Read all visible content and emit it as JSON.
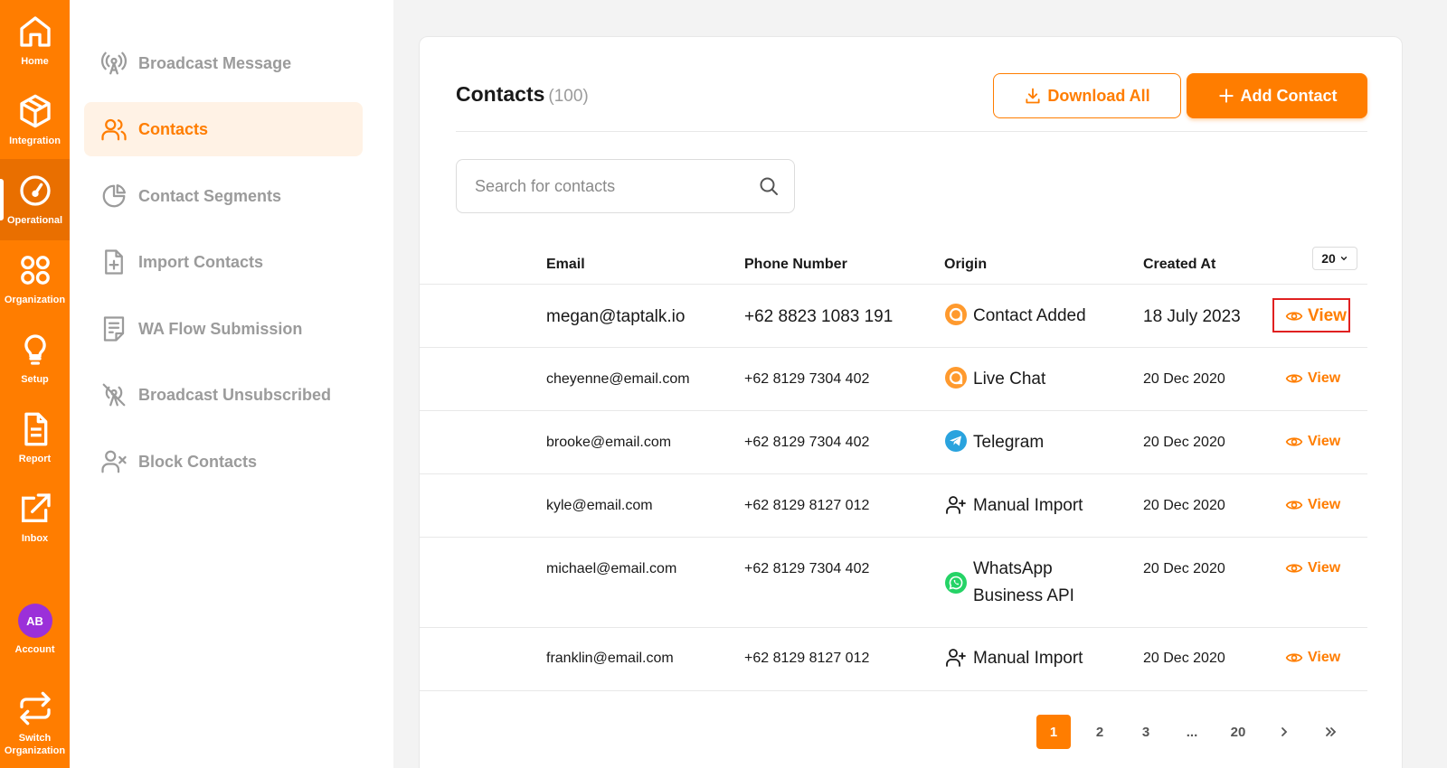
{
  "rail": {
    "home": "Home",
    "integration": "Integration",
    "operational": "Operational",
    "organization": "Organization",
    "setup": "Setup",
    "report": "Report",
    "inbox": "Inbox",
    "avatar_initials": "AB",
    "account": "Account",
    "switch_org": "Switch Organization"
  },
  "submenu": {
    "items": [
      {
        "label": "Broadcast Message",
        "icon": "broadcast-icon"
      },
      {
        "label": "Contacts",
        "icon": "contacts-icon",
        "active": true
      },
      {
        "label": "Contact Segments",
        "icon": "pie-chart-icon"
      },
      {
        "label": "Import Contacts",
        "icon": "file-plus-icon"
      },
      {
        "label": "WA Flow Submission",
        "icon": "form-icon"
      },
      {
        "label": "Broadcast Unsubscribed",
        "icon": "broadcast-off-icon"
      },
      {
        "label": "Block Contacts",
        "icon": "user-x-icon"
      }
    ]
  },
  "main": {
    "title": "Contacts",
    "count": "(100)",
    "download_label": "Download All",
    "add_label": "Add Contact",
    "search_placeholder": "Search for contacts",
    "per_page": "20"
  },
  "table": {
    "headers": {
      "email": "Email",
      "phone": "Phone Number",
      "origin": "Origin",
      "created": "Created At"
    },
    "view_label": "View",
    "rows": [
      {
        "email": "megan@taptalk.io",
        "phone": "+62 8823 1083 191",
        "origin": "Contact Added",
        "origin_icon": "livechat-icon",
        "created": "18 July 2023"
      },
      {
        "email": "cheyenne@email.com",
        "phone": "+62 8129 7304 402",
        "origin": "Live Chat",
        "origin_icon": "livechat-icon",
        "created": "20 Dec 2020"
      },
      {
        "email": "brooke@email.com",
        "phone": "+62 8129 7304 402",
        "origin": "Telegram",
        "origin_icon": "telegram-icon",
        "created": "20 Dec 2020"
      },
      {
        "email": "kyle@email.com",
        "phone": "+62 8129 8127 012",
        "origin": "Manual Import",
        "origin_icon": "user-plus-icon",
        "created": "20 Dec 2020"
      },
      {
        "email": "michael@email.com",
        "phone": "+62 8129 7304 402",
        "origin_line1": "WhatsApp",
        "origin_line2": "Business API",
        "origin_icon": "whatsapp-icon",
        "created": "20 Dec 2020"
      },
      {
        "email": "franklin@email.com",
        "phone": "+62 8129 8127 012",
        "origin": "Manual Import",
        "origin_icon": "user-plus-icon",
        "created": "20 Dec 2020"
      }
    ]
  },
  "pagination": {
    "pages": [
      "1",
      "2",
      "3",
      "...",
      "20"
    ],
    "current": "1"
  },
  "colors": {
    "accent": "#ff7d00",
    "highlight": "#e02020",
    "whatsapp": "#25d366",
    "telegram": "#2aa3de"
  }
}
